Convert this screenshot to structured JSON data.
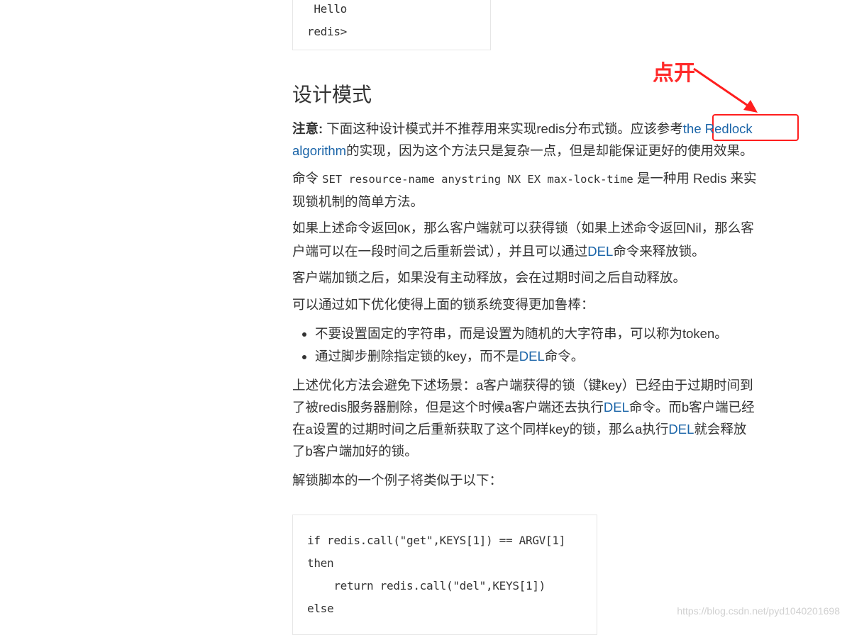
{
  "top_code": {
    "lines": [
      " Hello",
      "redis>"
    ]
  },
  "annotation": {
    "label": "点开",
    "color": "#ff2a2a"
  },
  "section": {
    "heading": "设计模式",
    "note_bold": "注意:",
    "note_text": " 下面这种设计模式并不推荐用来实现redis分布式锁。应该参考",
    "note_link_1": "the Redlock",
    "note_link_2": "algorithm",
    "note_text_2": "的实现，因为这个方法只是复杂一点，但是却能保证更好的使用效果。",
    "p2_prefix": "命令 ",
    "p2_code": "SET resource-name anystring NX EX max-lock-time",
    "p2_suffix_1": " 是一种用 Redis 来实",
    "p2_suffix_2": "现锁机制的简单方法。",
    "p3_line1_prefix": "如果上述命令返回",
    "p3_ok": "OK",
    "p3_line1_suffix": "，那么客户端就可以获得锁（如果上述命令返回Nil，那么客",
    "p3_line2_prefix": "户端可以在一段时间之后重新尝试），并且可以通过",
    "p3_del": "DEL",
    "p3_line2_suffix": "命令来释放锁。",
    "p4": "客户端加锁之后，如果没有主动释放，会在过期时间之后自动释放。",
    "p5": "可以通过如下优化使得上面的锁系统变得更加鲁棒：",
    "bullet1": "不要设置固定的字符串，而是设置为随机的大字符串，可以称为token。",
    "bullet2_prefix": "通过脚步删除指定锁的key，而不是",
    "bullet2_del": "DEL",
    "bullet2_suffix": "命令。",
    "p6_l1": "上述优化方法会避免下述场景：a客户端获得的锁（键key）已经由于过期时间到",
    "p6_l2_prefix": "了被redis服务器删除，但是这个时候a客户端还去执行",
    "p6_l2_del": "DEL",
    "p6_l2_suffix": "命令。而b客户端已经",
    "p6_l3_prefix": "在a设置的过期时间之后重新获取了这个同样key的锁，那么a执行",
    "p6_l3_del": "DEL",
    "p6_l3_suffix": "就会释放",
    "p6_l4": "了b客户端加好的锁。",
    "p7": "解锁脚本的一个例子将类似于以下："
  },
  "bottom_code": {
    "lines": [
      "if redis.call(\"get\",KEYS[1]) == ARGV[1]",
      "then",
      "    return redis.call(\"del\",KEYS[1])",
      "else"
    ]
  },
  "watermark": "https://blog.csdn.net/pyd1040201698",
  "colors": {
    "text": "#333333",
    "link": "#1a64a8",
    "annotation": "#ff1e1e"
  }
}
